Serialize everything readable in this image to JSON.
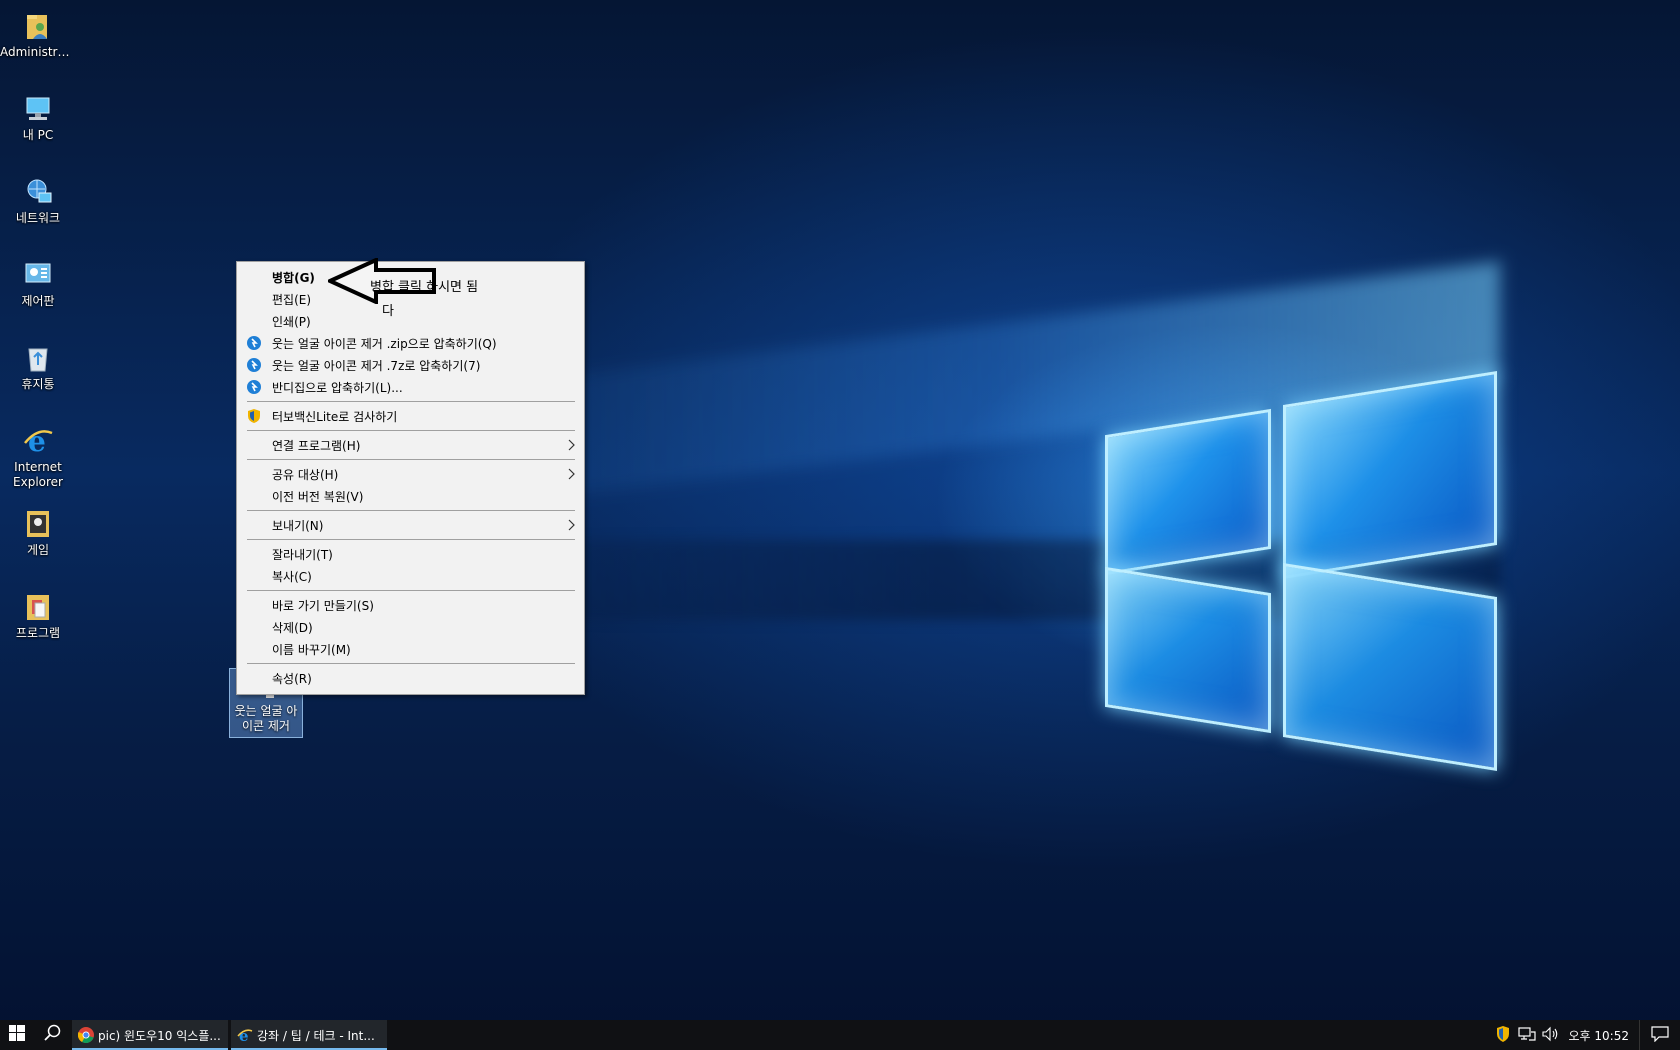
{
  "desktop": {
    "icons": [
      {
        "label": "Administra...",
        "icon": "user-folder-icon"
      },
      {
        "label": "내 PC",
        "icon": "computer-icon"
      },
      {
        "label": "네트워크",
        "icon": "network-icon"
      },
      {
        "label": "제어판",
        "icon": "control-panel-icon"
      },
      {
        "label": "휴지통",
        "icon": "recycle-bin-icon"
      },
      {
        "label": "Internet Explorer",
        "icon": "internet-explorer-icon"
      },
      {
        "label": "게임",
        "icon": "games-icon"
      },
      {
        "label": "프로그램",
        "icon": "programs-folder-icon"
      }
    ],
    "selected_file": {
      "label": "웃는 얼굴 아이콘 제거",
      "icon": "registry-file-icon"
    }
  },
  "context_menu": {
    "items": [
      {
        "label": "병합(G)",
        "bold": true
      },
      {
        "label": "편집(E)"
      },
      {
        "label": "인쇄(P)"
      },
      {
        "label": "웃는 얼굴 아이콘 제거 .zip으로 압축하기(Q)",
        "icon": "bandizip-icon"
      },
      {
        "label": "웃는 얼굴 아이콘 제거 .7z로 압축하기(7)",
        "icon": "bandizip-icon"
      },
      {
        "label": "반디집으로 압축하기(L)...",
        "icon": "bandizip-icon"
      },
      {
        "label": "터보백신Lite로 검사하기",
        "icon": "turbo-vaccine-shield-icon"
      },
      {
        "label": "연결 프로그램(H)",
        "submenu": true
      },
      {
        "label": "공유 대상(H)",
        "submenu": true
      },
      {
        "label": "이전 버전 복원(V)"
      },
      {
        "label": "보내기(N)",
        "submenu": true
      },
      {
        "label": "잘라내기(T)"
      },
      {
        "label": "복사(C)"
      },
      {
        "label": "바로 가기 만들기(S)"
      },
      {
        "label": "삭제(D)"
      },
      {
        "label": "이름 바꾸기(M)"
      },
      {
        "label": "속성(R)"
      }
    ]
  },
  "annotation": {
    "text": "병합 클릭 하시면 됨",
    "text_2": "다"
  },
  "taskbar": {
    "apps": [
      {
        "label": "pic) 윈도우10 익스플...",
        "icon": "chrome-icon"
      },
      {
        "label": "강좌 / 팁 / 테크 - Int...",
        "icon": "internet-explorer-icon"
      }
    ],
    "clock": "오후 10:52"
  },
  "colors": {
    "accent": "#76b9ed",
    "menu_bg": "#f2f2f2",
    "taskbar_bg": "#101114"
  }
}
